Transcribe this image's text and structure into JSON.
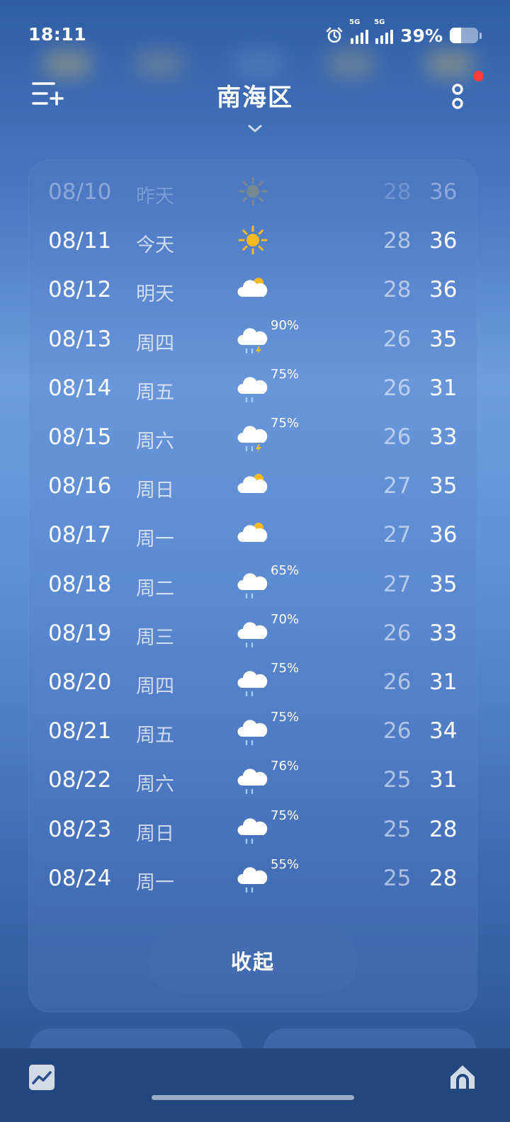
{
  "status_bar": {
    "time": "18:11",
    "network_1": "5G",
    "network_2": "5G",
    "battery": "39%",
    "battery_level": 0.39
  },
  "header": {
    "title": "南海区"
  },
  "forecast": [
    {
      "date": "08/10",
      "day": "昨天",
      "icon": "sun-icon",
      "prob": "",
      "low": "28",
      "high": "36"
    },
    {
      "date": "08/11",
      "day": "今天",
      "icon": "sun-icon",
      "prob": "",
      "low": "28",
      "high": "36"
    },
    {
      "date": "08/12",
      "day": "明天",
      "icon": "partly-cloudy-icon",
      "prob": "",
      "low": "28",
      "high": "36"
    },
    {
      "date": "08/13",
      "day": "周四",
      "icon": "thunderstorm-icon",
      "prob": "90%",
      "low": "26",
      "high": "35"
    },
    {
      "date": "08/14",
      "day": "周五",
      "icon": "rain-icon",
      "prob": "75%",
      "low": "26",
      "high": "31"
    },
    {
      "date": "08/15",
      "day": "周六",
      "icon": "thunderstorm-icon",
      "prob": "75%",
      "low": "26",
      "high": "33"
    },
    {
      "date": "08/16",
      "day": "周日",
      "icon": "partly-cloudy-icon",
      "prob": "",
      "low": "27",
      "high": "35"
    },
    {
      "date": "08/17",
      "day": "周一",
      "icon": "partly-cloudy-icon",
      "prob": "",
      "low": "27",
      "high": "36"
    },
    {
      "date": "08/18",
      "day": "周二",
      "icon": "rain-icon",
      "prob": "65%",
      "low": "27",
      "high": "35"
    },
    {
      "date": "08/19",
      "day": "周三",
      "icon": "rain-icon",
      "prob": "70%",
      "low": "26",
      "high": "33"
    },
    {
      "date": "08/20",
      "day": "周四",
      "icon": "rain-icon",
      "prob": "75%",
      "low": "26",
      "high": "31"
    },
    {
      "date": "08/21",
      "day": "周五",
      "icon": "rain-icon",
      "prob": "75%",
      "low": "26",
      "high": "34"
    },
    {
      "date": "08/22",
      "day": "周六",
      "icon": "rain-icon",
      "prob": "76%",
      "low": "25",
      "high": "31"
    },
    {
      "date": "08/23",
      "day": "周日",
      "icon": "rain-icon",
      "prob": "75%",
      "low": "25",
      "high": "28"
    },
    {
      "date": "08/24",
      "day": "周一",
      "icon": "rain-icon",
      "prob": "55%",
      "low": "25",
      "high": "28"
    }
  ],
  "collapse_label": "收起",
  "colors": {
    "sun": "#f7b91e",
    "sun_faded": "#c9a63a",
    "cloud": "#ffffff",
    "rain": "#9fd0ff",
    "lightning": "#f7c21e",
    "notification": "#ff3b3b"
  }
}
